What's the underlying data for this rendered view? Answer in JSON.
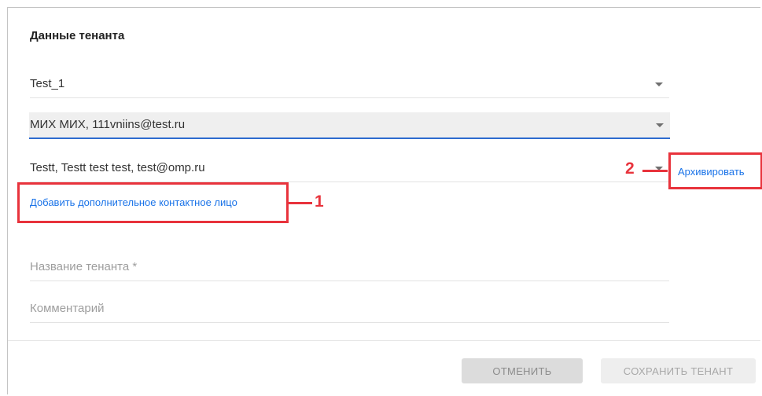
{
  "section": {
    "title": "Данные тенанта"
  },
  "fields": {
    "tenant_select": {
      "value": "Test_1"
    },
    "contact_primary": {
      "value": "МИХ МИХ, 111vniins@test.ru"
    },
    "contact_secondary": {
      "value": "Testt, Testt test test, test@omp.ru"
    },
    "tenant_name": {
      "placeholder": "Название тенанта *"
    },
    "comment": {
      "placeholder": "Комментарий"
    }
  },
  "links": {
    "add_contact": "Добавить дополнительное контактное лицо",
    "archive": "Архивировать"
  },
  "callouts": [
    "1",
    "2"
  ],
  "buttons": {
    "cancel": "ОТМЕНИТЬ",
    "save": "СОХРАНИТЬ ТЕНАНТ"
  },
  "colors": {
    "accent": "#2d6bcf",
    "link": "#1a73e8",
    "highlight": "#e8333c"
  },
  "icons": {
    "dropdown": "chevron-down-icon"
  }
}
